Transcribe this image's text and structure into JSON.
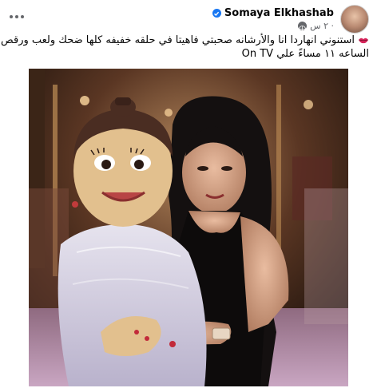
{
  "post": {
    "author": "Somaya Elkhashab",
    "time": "٢ س ·",
    "caption_lines": [
      "استنوني انهاردا انا والأرشانه صحبتي فاهيتا في حلقه خفيفه كلها ضحك ولعب ورقص",
      "الساعه ١١ مساءً علي On TV"
    ]
  },
  "icons": {
    "more": "more-options-icon",
    "verified": "verified-badge-icon",
    "privacy": "globe-icon",
    "emoji": "lips-emoji-icon"
  },
  "colors": {
    "accent": "#1877f2",
    "text": "#050505",
    "secondary": "#65676b"
  }
}
